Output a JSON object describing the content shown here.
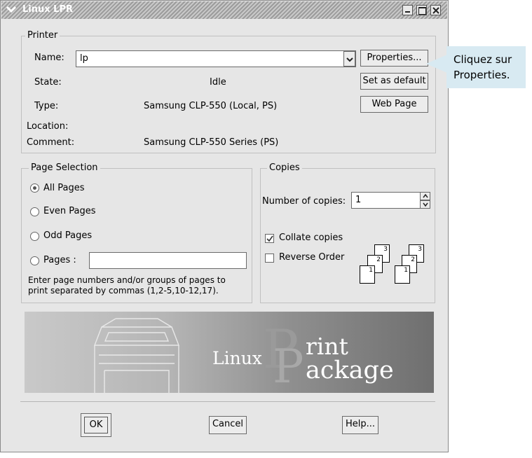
{
  "window": {
    "title": "Linux LPR"
  },
  "printer": {
    "group_label": "Printer",
    "name_label": "Name:",
    "name_value": "lp",
    "state_label": "State:",
    "state_value": "Idle",
    "type_label": "Type:",
    "type_value": "Samsung CLP-550 (Local, PS)",
    "location_label": "Location:",
    "location_value": "",
    "comment_label": "Comment:",
    "comment_value": "Samsung CLP-550 Series (PS)",
    "properties_button": "Properties...",
    "set_default_button": "Set as default",
    "web_page_button": "Web Page"
  },
  "page_selection": {
    "group_label": "Page Selection",
    "options": [
      {
        "label": "All Pages",
        "selected": true
      },
      {
        "label": "Even Pages",
        "selected": false
      },
      {
        "label": "Odd Pages",
        "selected": false
      },
      {
        "label": "Pages :",
        "selected": false
      }
    ],
    "pages_value": "",
    "hint_line1": "Enter page numbers and/or groups of pages to",
    "hint_line2": "print separated by commas (1,2-5,10-12,17)."
  },
  "copies": {
    "group_label": "Copies",
    "number_label": "Number of copies:",
    "number_value": "1",
    "collate_label": "Collate copies",
    "collate_checked": true,
    "reverse_label": "Reverse Order",
    "reverse_checked": false,
    "page_numbers": [
      "3",
      "2",
      "1",
      "3",
      "2",
      "1"
    ]
  },
  "banner": {
    "text_linux": "Linux",
    "text_print": "rint",
    "text_package": "ackage",
    "letter_p1": "P",
    "letter_p2": "P"
  },
  "buttons": {
    "ok": "OK",
    "cancel": "Cancel",
    "help": "Help..."
  },
  "callout": {
    "line1": "Cliquez sur",
    "line2": "Properties."
  },
  "colors": {
    "window_bg": "#e6e6e6",
    "callout_bg": "#d8eaf2",
    "title_bar": "#9c9c9c"
  }
}
